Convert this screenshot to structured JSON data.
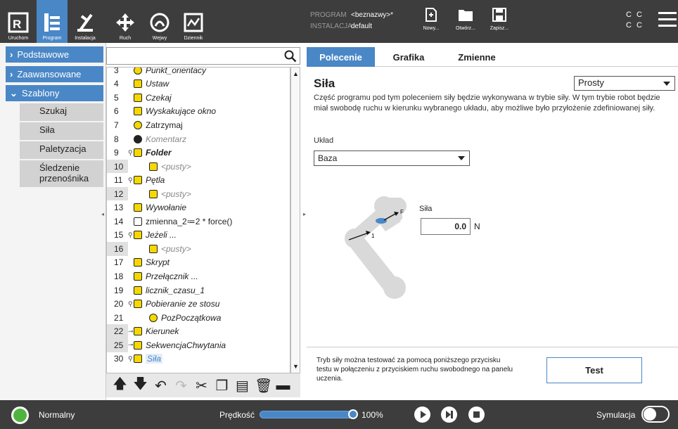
{
  "topbar": {
    "buttons": [
      {
        "label": "Uruchom",
        "icon": "ur-logo-icon"
      },
      {
        "label": "Program",
        "icon": "program-icon"
      },
      {
        "label": "Instalacja",
        "icon": "installation-icon"
      },
      {
        "label": "Ruch",
        "icon": "move-icon"
      },
      {
        "label": "Wejwy",
        "icon": "io-icon"
      },
      {
        "label": "Dziennik",
        "icon": "log-icon"
      }
    ],
    "program_label": "PROGRAM",
    "program_value": "<beznazwy>*",
    "installation_label": "INSTALACJA",
    "installation_value": "default",
    "file_buttons": [
      {
        "label": "Nowy...",
        "icon": "new-file-icon"
      },
      {
        "label": "Otwórz...",
        "icon": "open-folder-icon"
      },
      {
        "label": "Zapisz...",
        "icon": "save-icon"
      }
    ],
    "cc_line1": "C C",
    "cc_line2": "C C"
  },
  "leftnav": {
    "headers": [
      {
        "label": "Podstawowe"
      },
      {
        "label": "Zaawansowane"
      },
      {
        "label": "Szablony"
      }
    ],
    "sub_items": [
      {
        "label": "Szukaj"
      },
      {
        "label": "Siła"
      },
      {
        "label": "Paletyzacja"
      },
      {
        "label": "Śledzenie przenośnika"
      }
    ]
  },
  "search": {
    "placeholder": ""
  },
  "tree": {
    "rows": [
      {
        "num": "3",
        "text": "Punkt_orientacy",
        "icon": "waypoint-icon"
      },
      {
        "num": "4",
        "text": "Ustaw",
        "icon": "set-icon"
      },
      {
        "num": "5",
        "text": "Czekaj",
        "icon": "wait-icon"
      },
      {
        "num": "6",
        "text": "Wyskakujące okno",
        "icon": "popup-icon"
      },
      {
        "num": "7",
        "text": "Zatrzymaj",
        "icon": "halt-icon"
      },
      {
        "num": "8",
        "text": "Komentarz",
        "icon": "comment-icon"
      },
      {
        "num": "9",
        "text": "Folder",
        "icon": "folder-icon"
      },
      {
        "num": "10",
        "text": "<pusty>",
        "icon": "empty-icon"
      },
      {
        "num": "11",
        "text": "Pętla",
        "icon": "loop-icon"
      },
      {
        "num": "12",
        "text": "<pusty>",
        "icon": "empty-icon"
      },
      {
        "num": "13",
        "text": "Wywołanie",
        "icon": "call-icon"
      },
      {
        "num": "14",
        "text": "zmienna_2≔2 * force()",
        "icon": "assignment-icon"
      },
      {
        "num": "15",
        "text": "Jeżeli ...",
        "icon": "if-icon"
      },
      {
        "num": "16",
        "text": "<pusty>",
        "icon": "empty-icon"
      },
      {
        "num": "17",
        "text": "Skrypt",
        "icon": "script-icon"
      },
      {
        "num": "18",
        "text": "Przełącznik ...",
        "icon": "switch-icon"
      },
      {
        "num": "19",
        "text": "licznik_czasu_1",
        "icon": "timer-icon"
      },
      {
        "num": "20",
        "text": "Pobieranie ze stosu",
        "icon": "destack-icon"
      },
      {
        "num": "21",
        "text": "PozPoczątkowa",
        "icon": "waypoint-icon"
      },
      {
        "num": "22",
        "text": "Kierunek",
        "icon": "direction-icon"
      },
      {
        "num": "25",
        "text": "SekwencjaChwytania",
        "icon": "sequence-icon"
      },
      {
        "num": "30",
        "text": "Siła",
        "icon": "force-icon"
      }
    ]
  },
  "tabs": [
    {
      "label": "Polecenie"
    },
    {
      "label": "Grafika"
    },
    {
      "label": "Zmienne"
    }
  ],
  "command": {
    "title": "Siła",
    "mode_value": "Prosty",
    "description": "Część programu pod tym poleceniem siły będzie wykonywana w trybie siły. W tym trybie robot będzie miał swobodę ruchu w kierunku wybranego układu, aby możliwe było przyłożenie zdefiniowanej siły.",
    "frame_label": "Układ",
    "frame_value": "Baza",
    "force_label": "Siła",
    "force_value": "0.0",
    "force_unit": "N",
    "diagram_label_f": "F",
    "diagram_label_1": "1",
    "test_description": "Tryb siły można testować za pomocą poniższego przycisku testu w połączeniu z przyciskiem ruchu swobodnego na panelu uczenia.",
    "test_button": "Test"
  },
  "footer": {
    "status": "Normalny",
    "speed_label": "Prędkość",
    "speed_value": "100%",
    "speed_fraction": 1.0,
    "simulation_label": "Symulacja"
  },
  "colors": {
    "accent": "#4a87c6",
    "topbar": "#3d3d3d",
    "status_ok": "#4fb43f",
    "icon_yellow": "#f5d800"
  }
}
